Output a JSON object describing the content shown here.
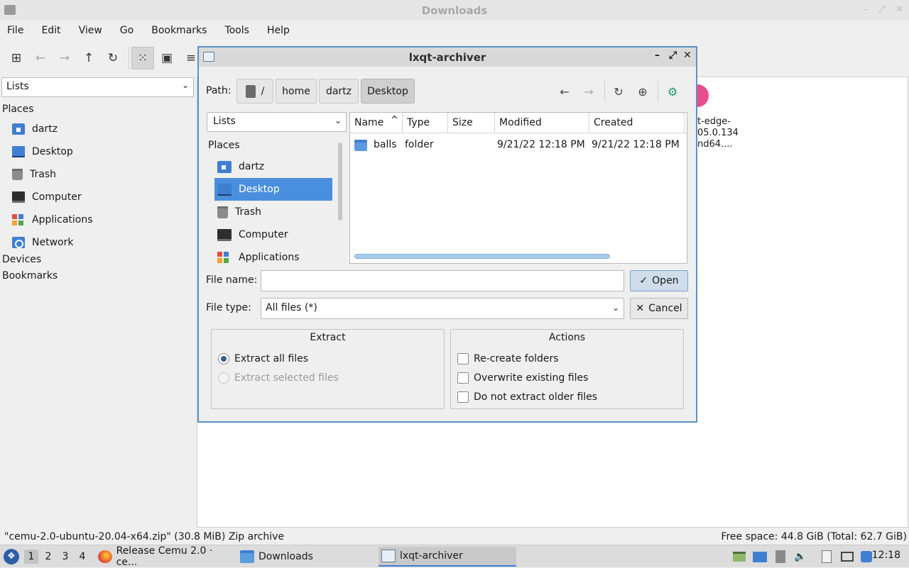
{
  "file_manager": {
    "title": "Downloads",
    "menu": [
      "File",
      "Edit",
      "View",
      "Go",
      "Bookmarks",
      "Tools",
      "Help"
    ],
    "view_combo": "Lists",
    "sidebar": {
      "places_header": "Places",
      "items": [
        {
          "label": "dartz",
          "icon": "home-folder-icon"
        },
        {
          "label": "Desktop",
          "icon": "desktop-icon"
        },
        {
          "label": "Trash",
          "icon": "trash-icon"
        },
        {
          "label": "Computer",
          "icon": "computer-icon"
        },
        {
          "label": "Applications",
          "icon": "applications-icon"
        },
        {
          "label": "Network",
          "icon": "network-icon"
        }
      ],
      "devices_header": "Devices",
      "bookmarks_header": "Bookmarks"
    },
    "partial_file_label": [
      "t-edge-",
      "05.0.134",
      "nd64...."
    ],
    "status_left": "\"cemu-2.0-ubuntu-20.04-x64.zip\" (30.8 MiB) Zip archive",
    "status_right": "Free space: 44.8 GiB (Total: 62.7 GiB)"
  },
  "dialog": {
    "title": "lxqt-archiver",
    "path_label": "Path:",
    "crumbs": [
      "/",
      "home",
      "dartz",
      "Desktop"
    ],
    "view_combo": "Lists",
    "places_header": "Places",
    "places": [
      {
        "label": "dartz",
        "icon": "home-folder-icon"
      },
      {
        "label": "Desktop",
        "icon": "desktop-icon",
        "selected": true
      },
      {
        "label": "Trash",
        "icon": "trash-icon"
      },
      {
        "label": "Computer",
        "icon": "computer-icon"
      },
      {
        "label": "Applications",
        "icon": "applications-icon"
      }
    ],
    "columns": [
      "Name",
      "Type",
      "Size",
      "Modified",
      "Created"
    ],
    "files": [
      {
        "name": "balls",
        "type": "folder",
        "size": "",
        "modified": "9/21/22 12:18 PM",
        "created": "9/21/22 12:18 PM"
      }
    ],
    "file_name_label": "File name:",
    "file_name_value": "",
    "file_type_label": "File type:",
    "file_type_value": "All files (*)",
    "open_label": "Open",
    "cancel_label": "Cancel",
    "extract": {
      "title": "Extract",
      "all_label": "Extract all files",
      "selected_label": "Extract selected files"
    },
    "actions": {
      "title": "Actions",
      "recreate_label": "Re-create folders",
      "overwrite_label": "Overwrite existing files",
      "older_label": "Do not extract older files"
    }
  },
  "taskbar": {
    "workspaces": [
      "1",
      "2",
      "3",
      "4"
    ],
    "tasks": [
      "Release Cemu 2.0 · ce...",
      "Downloads",
      "lxqt-archiver"
    ],
    "clock": "12:18"
  },
  "colors": {
    "accent": "#4a8fde",
    "dialog_border": "#5a92c9"
  }
}
